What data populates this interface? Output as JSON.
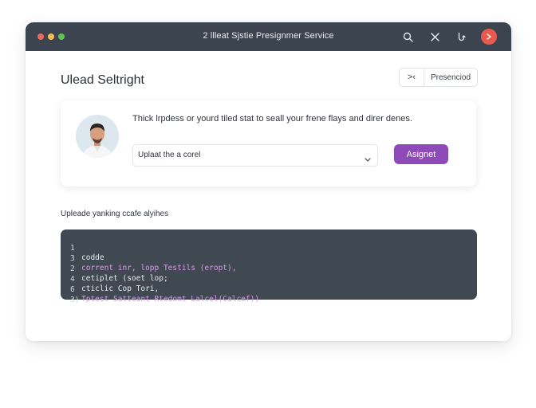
{
  "window": {
    "title": "2 llleat Sjstie Presignmer Service",
    "dot_colors": [
      "#ec6a5e",
      "#f4bf4f",
      "#61c554"
    ],
    "actions": [
      {
        "name": "search-icon"
      },
      {
        "name": "close-icon"
      },
      {
        "name": "refresh-icon"
      },
      {
        "name": "avatar"
      }
    ]
  },
  "header": {
    "title": "Ulead Seltright",
    "toggle_label": ">‹",
    "present_label": "Presenciod"
  },
  "card": {
    "description": "Thick lrpdess or yourd tiled stat to seall your frene flays and direr denes.",
    "select": {
      "value": "Uplaat the a corel"
    },
    "assign_label": "Asignet"
  },
  "code_section": {
    "label": "Upleade yanking ccafe alyihes"
  },
  "code": {
    "lines": [
      {
        "n": "1",
        "text": "codde"
      },
      {
        "n": "3",
        "text": "corrent inr, lopp Testils (eropt),"
      },
      {
        "n": "2",
        "text": "cetiplet (soet lop;"
      },
      {
        "n": "4",
        "text": "cticlic Cop Tori,"
      },
      {
        "n": "6",
        "text": "Tptest Satteant Rtedomt Lalcel(Calcef))"
      },
      {
        "n": "3)",
        "text": ""
      }
    ]
  },
  "colors": {
    "titlebar": "#3c4450",
    "accent": "#8e4ab8",
    "code_bg": "#404952",
    "avatar_bg": "#e85a4f"
  }
}
